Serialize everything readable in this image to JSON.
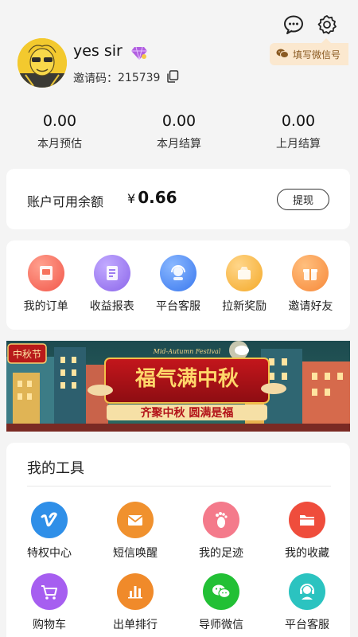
{
  "header": {
    "username": "yes sir",
    "invite_label": "邀请码：",
    "invite_code": "215739",
    "wechat_button": "填写微信号",
    "icons": [
      "chat-bubble-icon",
      "gear-icon",
      "diamond-icon",
      "copy-icon",
      "wechat-icon"
    ]
  },
  "stats": [
    {
      "value": "0.00",
      "label": "本月预估"
    },
    {
      "value": "0.00",
      "label": "本月结算"
    },
    {
      "value": "0.00",
      "label": "上月结算"
    }
  ],
  "balance": {
    "label": "账户可用余额",
    "currency": "¥",
    "amount": "0.66",
    "withdraw": "提现"
  },
  "quick_actions": [
    {
      "label": "我的订单",
      "icon": "order-icon",
      "color": "#f7715c"
    },
    {
      "label": "收益报表",
      "icon": "report-icon",
      "color": "#9e7cf0"
    },
    {
      "label": "平台客服",
      "icon": "service-icon",
      "color": "#4f8ef5"
    },
    {
      "label": "拉新奖励",
      "icon": "reward-icon",
      "color": "#f6b43c"
    },
    {
      "label": "邀请好友",
      "icon": "gift-icon",
      "color": "#f89a45"
    }
  ],
  "banner": {
    "main_text": "福气满中秋",
    "sub_text": "齐聚中秋 圆满是福",
    "tag": "中秋节",
    "en_text": "Mid-Autumn Festival"
  },
  "tools": {
    "title": "我的工具",
    "items": [
      {
        "label": "特权中心",
        "icon": "vimeo-icon",
        "color": "#2f8fe8"
      },
      {
        "label": "短信唤醒",
        "icon": "envelope-icon",
        "color": "#f0912e"
      },
      {
        "label": "我的足迹",
        "icon": "footprint-icon",
        "color": "#f47a8b"
      },
      {
        "label": "我的收藏",
        "icon": "folder-icon",
        "color": "#ef4d3c"
      },
      {
        "label": "购物车",
        "icon": "cart-icon",
        "color": "#a65ef0"
      },
      {
        "label": "出单排行",
        "icon": "bar-chart-icon",
        "color": "#f08a2a"
      },
      {
        "label": "导师微信",
        "icon": "wechat-icon",
        "color": "#22c035"
      },
      {
        "label": "平台客服",
        "icon": "headset-icon",
        "color": "#2bc3c0"
      }
    ]
  }
}
